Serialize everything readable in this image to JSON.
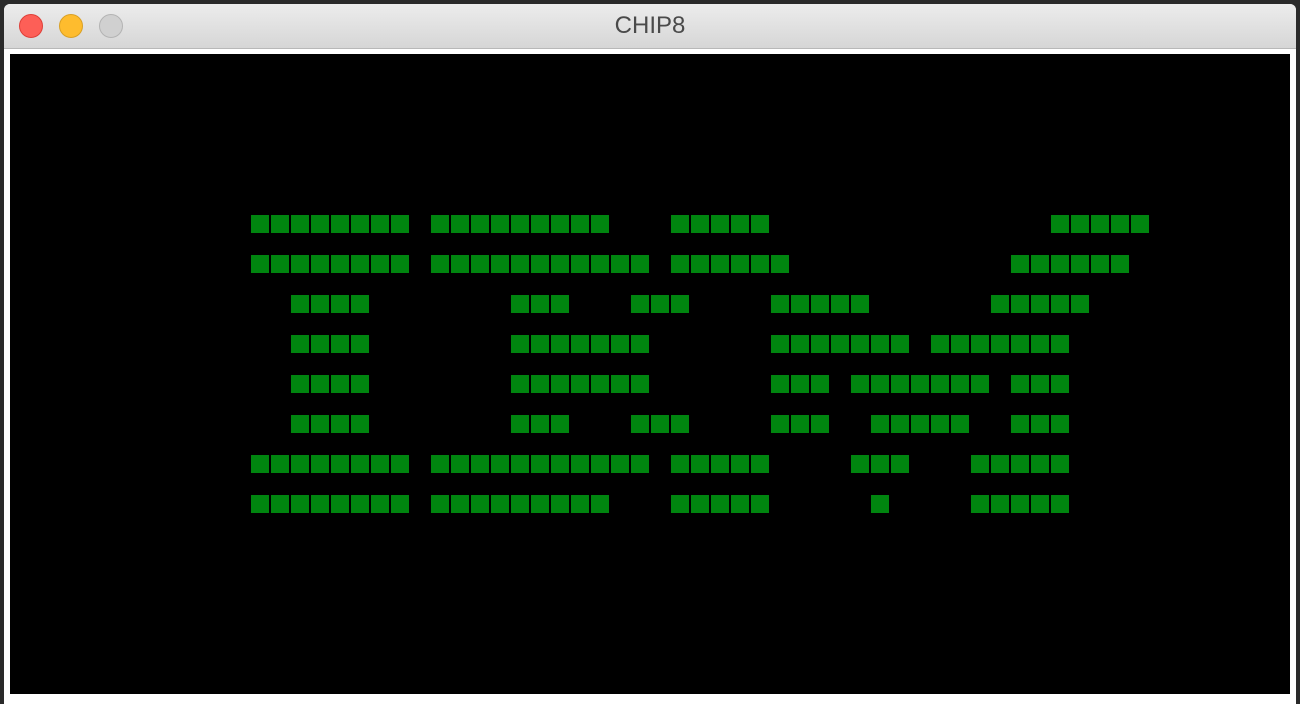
{
  "window": {
    "title": "CHIP8"
  },
  "display": {
    "columns": 64,
    "rows": 32,
    "pixel_on_color": "#00850f",
    "pixel_off_color": "#000000",
    "framebuffer": [
      "0000000000000000000000000000000000000000000000000000000000000000",
      "0000000000000000000000000000000000000000000000000000000000000000",
      "0000000000000000000000000000000000000000000000000000000000000000",
      "0000000000000000000000000000000000000000000000000000000000000000",
      "0000000000000000000000000000000000000000000000000000000000000000",
      "0000000000000000000000000000000000000000000000000000000000000000",
      "0000000000000000000000000000000000000000000000000000000000000000",
      "0000000000000000000000000000000000000000000000000000000000000000",
      "0000000000001111111101111111110001111100000000000000111110000000",
      "0000000000000000000000000000000000000000000000000000000000000000",
      "0000000000001111111101111111111101111110000000000011111100000000",
      "0000000000000000000000000000000000000000000000000000000000000000",
      "0000000000000011110000000111000111000011111000000111110000000000",
      "0000000000000000000000000000000000000000000000000000000000000000",
      "0000000000000011110000000111111100000011111110111111100000000000",
      "0000000000000000000000000000000000000000000000000000000000000000",
      "0000000000000011110000000111111100000011101111111011100000000000",
      "0000000000000000000000000000000000000000000000000000000000000000",
      "0000000000000011110000000111000111000011100111110011100000000000",
      "0000000000000000000000000000000000000000000000000000000000000000",
      "0000000000001111111101111111111101111100001110001111100000000000",
      "0000000000000000000000000000000000000000000000000000000000000000",
      "0000000000001111111101111111110001111100000100001111100000000000",
      "0000000000000000000000000000000000000000000000000000000000000000",
      "0000000000000000000000000000000000000000000000000000000000000000",
      "0000000000000000000000000000000000000000000000000000000000000000",
      "0000000000000000000000000000000000000000000000000000000000000000",
      "0000000000000000000000000000000000000000000000000000000000000000",
      "0000000000000000000000000000000000000000000000000000000000000000",
      "0000000000000000000000000000000000000000000000000000000000000000",
      "0000000000000000000000000000000000000000000000000000000000000000",
      "0000000000000000000000000000000000000000000000000000000000000000"
    ]
  }
}
